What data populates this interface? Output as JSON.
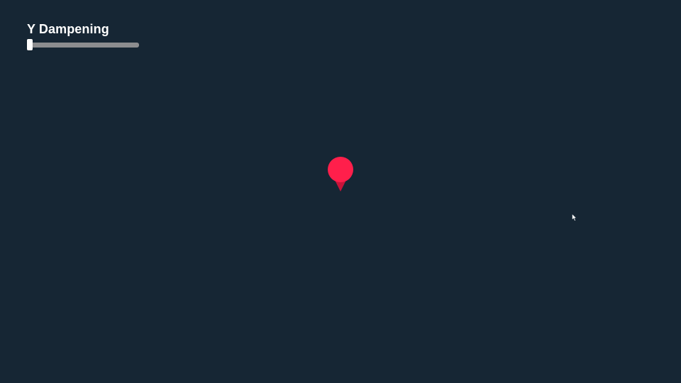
{
  "controls": {
    "y_dampening": {
      "label": "Y Dampening",
      "value_fraction": 0.0
    }
  },
  "marker": {
    "icon": "map-pin-icon",
    "color": "#ff1f4b",
    "tip_color": "#c8143a"
  },
  "pointer": {
    "icon": "mouse-cursor-icon"
  },
  "colors": {
    "background": "#162634",
    "slider_track": "#8c8d8f",
    "slider_thumb": "#ffffff",
    "label": "#ffffff"
  }
}
